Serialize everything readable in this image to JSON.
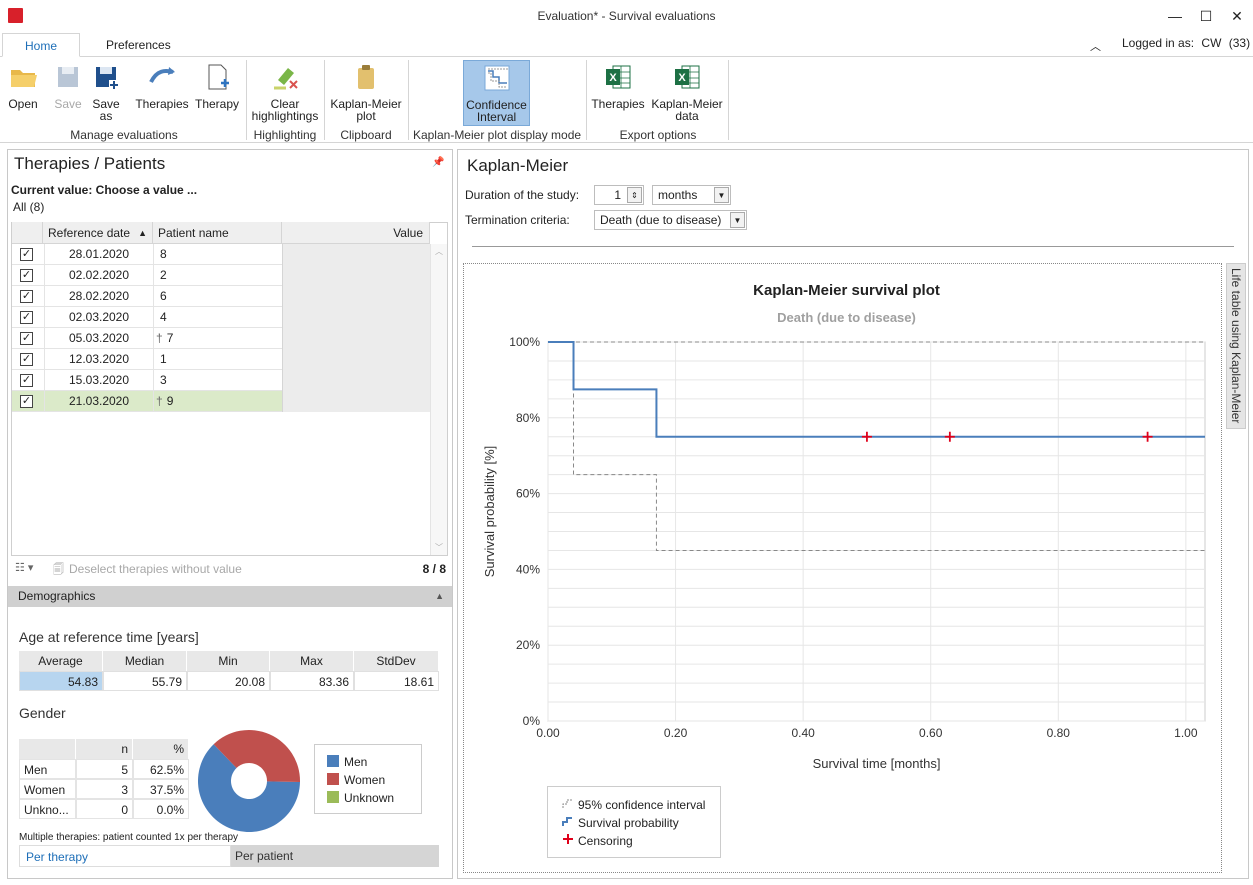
{
  "window": {
    "title": "Evaluation* - Survival evaluations",
    "minimize": "—",
    "maximize": "☐",
    "close": "✕"
  },
  "tabs": {
    "home": "Home",
    "preferences": "Preferences"
  },
  "login": {
    "label": "Logged in as:",
    "user": "CW",
    "count": "(33)"
  },
  "ribbon": {
    "open": "Open",
    "save": "Save",
    "save_as_1": "Save",
    "save_as_2": "as",
    "therapies": "Therapies",
    "therapy": "Therapy",
    "group_manage": "Manage evaluations",
    "clear_1": "Clear",
    "clear_2": "highlightings",
    "group_highlight": "Highlighting",
    "km_plot_1": "Kaplan-Meier",
    "km_plot_2": "plot",
    "group_clipboard": "Clipboard",
    "ci_1": "Confidence",
    "ci_2": "Interval",
    "group_display": "Kaplan-Meier plot display mode",
    "exp_therapies": "Therapies",
    "exp_km_1": "Kaplan-Meier",
    "exp_km_2": "data",
    "group_export": "Export options"
  },
  "left": {
    "title": "Therapies / Patients",
    "current_value": "Current value: Choose a value ...",
    "all": "All (8)",
    "columns": {
      "date": "Reference date",
      "name": "Patient name",
      "value": "Value"
    },
    "rows": [
      {
        "date": "28.01.2020",
        "name": "8",
        "dagger": ""
      },
      {
        "date": "02.02.2020",
        "name": "2",
        "dagger": ""
      },
      {
        "date": "28.02.2020",
        "name": "6",
        "dagger": ""
      },
      {
        "date": "02.03.2020",
        "name": "4",
        "dagger": ""
      },
      {
        "date": "05.03.2020",
        "name": "7",
        "dagger": "†"
      },
      {
        "date": "12.03.2020",
        "name": "1",
        "dagger": ""
      },
      {
        "date": "15.03.2020",
        "name": "3",
        "dagger": ""
      },
      {
        "date": "21.03.2020",
        "name": "9",
        "dagger": "†"
      }
    ],
    "deselect": "Deselect therapies without value",
    "counter": "8 / 8"
  },
  "demographics": {
    "header": "Demographics",
    "age_title": "Age at reference time [years]",
    "age_headers": [
      "Average",
      "Median",
      "Min",
      "Max",
      "StdDev"
    ],
    "age_values": [
      "54.83",
      "55.79",
      "20.08",
      "83.36",
      "18.61"
    ],
    "gender_title": "Gender",
    "gender_headers": [
      "",
      "n",
      "%"
    ],
    "gender_rows": [
      {
        "label": "Men",
        "n": "5",
        "pct": "62.5%"
      },
      {
        "label": "Women",
        "n": "3",
        "pct": "37.5%"
      },
      {
        "label": "Unkno...",
        "n": "0",
        "pct": "0.0%"
      }
    ],
    "gender_legend": [
      "Men",
      "Women",
      "Unknown"
    ],
    "pie": [
      {
        "label": "Men",
        "value": 62.5,
        "color": "#4a7ebb"
      },
      {
        "label": "Women",
        "value": 37.5,
        "color": "#c0504d"
      },
      {
        "label": "Unknown",
        "value": 0,
        "color": "#9bbb59"
      }
    ],
    "note": "Multiple therapies: patient counted 1x per therapy",
    "per_therapy": "Per therapy",
    "per_patient": "Per patient"
  },
  "km": {
    "title": "Kaplan-Meier",
    "duration_label": "Duration of the study:",
    "duration_value": "1",
    "duration_unit": "months",
    "termination_label": "Termination criteria:",
    "termination_value": "Death (due to disease)",
    "side_tab": "Life table using Kaplan-Meier"
  },
  "chart_data": {
    "type": "line",
    "title": "Kaplan-Meier survival plot",
    "subtitle": "Death (due to disease)",
    "xlabel": "Survival time [months]",
    "ylabel": "Survival probability [%]",
    "xlim": [
      0,
      1.03
    ],
    "ylim": [
      0,
      100
    ],
    "xticks": [
      "0.00",
      "0.20",
      "0.40",
      "0.60",
      "0.80",
      "1.00"
    ],
    "yticks": [
      "0%",
      "20%",
      "40%",
      "60%",
      "80%",
      "100%"
    ],
    "series": [
      {
        "name": "Survival probability",
        "x": [
          0,
          0.04,
          0.04,
          0.17,
          0.17,
          1.03
        ],
        "y": [
          100,
          100,
          87.5,
          87.5,
          75,
          75
        ],
        "color": "#4a7ebb"
      },
      {
        "name": "95% confidence interval",
        "upper_x": [
          0,
          1.03
        ],
        "upper_y": [
          100,
          100
        ],
        "lower_x": [
          0,
          0.04,
          0.04,
          0.17,
          0.17,
          1.03
        ],
        "lower_y": [
          100,
          100,
          65,
          65,
          45,
          45
        ],
        "color": "#888888"
      }
    ],
    "censoring": {
      "name": "Censoring",
      "x": [
        0.5,
        0.63,
        0.94
      ],
      "y": [
        75,
        75,
        75
      ],
      "color": "#e0001a"
    },
    "grid": true,
    "legend": [
      "95% confidence interval",
      "Survival probability",
      "Censoring"
    ]
  }
}
